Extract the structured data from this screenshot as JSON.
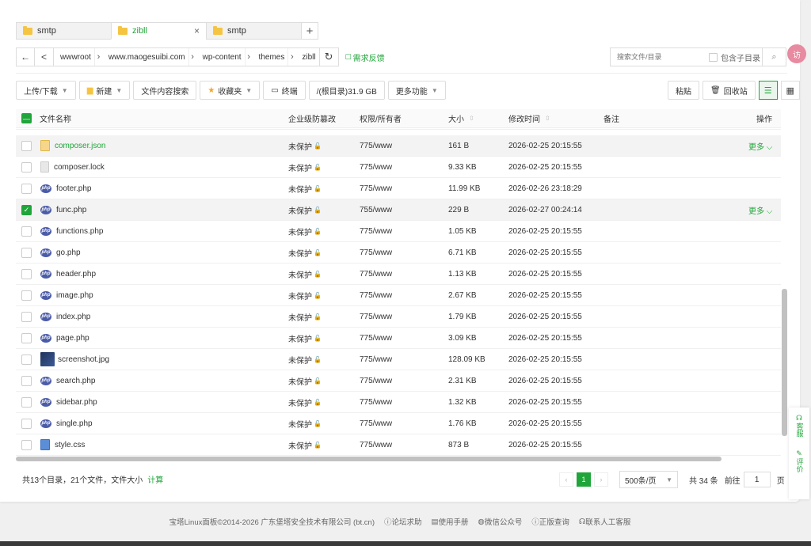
{
  "tabs": [
    {
      "label": "smtp",
      "active": false
    },
    {
      "label": "zibll",
      "active": true,
      "close": "×"
    },
    {
      "label": "smtp",
      "active": false
    }
  ],
  "tab_add": "+",
  "path": {
    "back": "←",
    "up": "<",
    "crumbs": [
      "wwwroot",
      "www.maogesuibi.com",
      "wp-content",
      "themes",
      "zibll"
    ],
    "refresh": "↻",
    "feedback": "需求反馈"
  },
  "search": {
    "placeholder": "搜索文件/目录",
    "subdir_label": "包含子目录"
  },
  "toolbar": {
    "upload": "上传/下载",
    "new": "新建",
    "content_search": "文件内容搜索",
    "favorites": "收藏夹",
    "terminal": "终端",
    "disk": "/(根目录)31.9 GB",
    "more": "更多功能",
    "paste": "粘贴",
    "recycle": "回收站"
  },
  "columns": {
    "name": "文件名称",
    "protect": "企业级防篡改",
    "perm": "权限/所有者",
    "size": "大小",
    "mtime": "修改时间",
    "note": "备注",
    "ops": "操作"
  },
  "files": [
    {
      "name": "composer.json",
      "icon": "json",
      "protect": "未保护",
      "perm": "775/www",
      "size": "161 B",
      "mtime": "2026-02-25 20:15:55",
      "checked": false,
      "hl": true,
      "more": "更多",
      "green": true
    },
    {
      "name": "composer.lock",
      "icon": "doc",
      "protect": "未保护",
      "perm": "775/www",
      "size": "9.33 KB",
      "mtime": "2026-02-25 20:15:55",
      "checked": false
    },
    {
      "name": "footer.php",
      "icon": "php",
      "protect": "未保护",
      "perm": "775/www",
      "size": "11.99 KB",
      "mtime": "2026-02-26 23:18:29",
      "checked": false
    },
    {
      "name": "func.php",
      "icon": "php",
      "protect": "未保护",
      "perm": "755/www",
      "size": "229 B",
      "mtime": "2026-02-27 00:24:14",
      "checked": true,
      "hl": true,
      "more": "更多"
    },
    {
      "name": "functions.php",
      "icon": "php",
      "protect": "未保护",
      "perm": "775/www",
      "size": "1.05 KB",
      "mtime": "2026-02-25 20:15:55",
      "checked": false
    },
    {
      "name": "go.php",
      "icon": "php",
      "protect": "未保护",
      "perm": "775/www",
      "size": "6.71 KB",
      "mtime": "2026-02-25 20:15:55",
      "checked": false
    },
    {
      "name": "header.php",
      "icon": "php",
      "protect": "未保护",
      "perm": "775/www",
      "size": "1.13 KB",
      "mtime": "2026-02-25 20:15:55",
      "checked": false
    },
    {
      "name": "image.php",
      "icon": "php",
      "protect": "未保护",
      "perm": "775/www",
      "size": "2.67 KB",
      "mtime": "2026-02-25 20:15:55",
      "checked": false
    },
    {
      "name": "index.php",
      "icon": "php",
      "protect": "未保护",
      "perm": "775/www",
      "size": "1.79 KB",
      "mtime": "2026-02-25 20:15:55",
      "checked": false
    },
    {
      "name": "page.php",
      "icon": "php",
      "protect": "未保护",
      "perm": "775/www",
      "size": "3.09 KB",
      "mtime": "2026-02-25 20:15:55",
      "checked": false
    },
    {
      "name": "screenshot.jpg",
      "icon": "img",
      "protect": "未保护",
      "perm": "775/www",
      "size": "128.09 KB",
      "mtime": "2026-02-25 20:15:55",
      "checked": false
    },
    {
      "name": "search.php",
      "icon": "php",
      "protect": "未保护",
      "perm": "775/www",
      "size": "2.31 KB",
      "mtime": "2026-02-25 20:15:55",
      "checked": false
    },
    {
      "name": "sidebar.php",
      "icon": "php",
      "protect": "未保护",
      "perm": "775/www",
      "size": "1.32 KB",
      "mtime": "2026-02-25 20:15:55",
      "checked": false
    },
    {
      "name": "single.php",
      "icon": "php",
      "protect": "未保护",
      "perm": "775/www",
      "size": "1.76 KB",
      "mtime": "2026-02-25 20:15:55",
      "checked": false
    },
    {
      "name": "style.css",
      "icon": "css",
      "protect": "未保护",
      "perm": "775/www",
      "size": "873 B",
      "mtime": "2026-02-25 20:15:55",
      "checked": false
    }
  ],
  "footer": {
    "summary": "共13个目录，21个文件，文件大小",
    "calc": "计算",
    "current_page": "1",
    "page_size": "500条/页",
    "total": "共 34 条",
    "goto_label": "前往",
    "goto_value": "1",
    "page_unit": "页"
  },
  "copyright": {
    "text": "宝塔Linux面板©2014-2026 广东堡塔安全技术有限公司 (bt.cn)",
    "links": [
      "论坛求助",
      "使用手册",
      "微信公众号",
      "正版查询",
      "联系人工客服"
    ]
  },
  "side": {
    "service": "客服",
    "review": "评价"
  },
  "avatar": "访",
  "colors": {
    "accent": "#20a53a",
    "php_icon": "#4a5ba8"
  }
}
